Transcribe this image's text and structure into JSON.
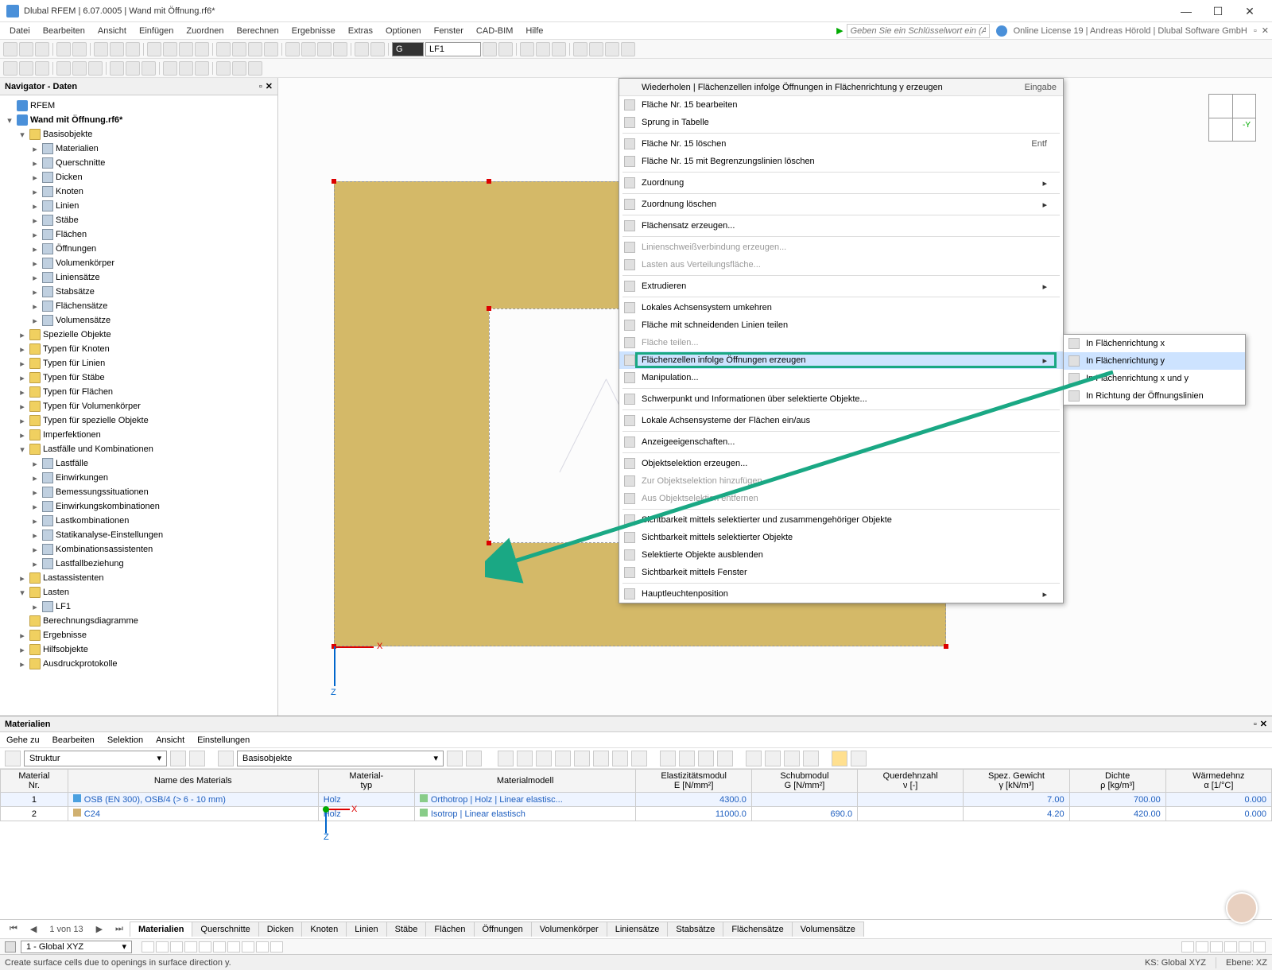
{
  "window": {
    "title": "Dlubal RFEM | 6.07.0005 | Wand mit Öffnung.rf6*",
    "license": "Online License 19 | Andreas Hörold | Dlubal Software GmbH",
    "search_placeholder": "Geben Sie ein Schlüsselwort ein (Alt..."
  },
  "menu": [
    "Datei",
    "Bearbeiten",
    "Ansicht",
    "Einfügen",
    "Zuordnen",
    "Berechnen",
    "Ergebnisse",
    "Extras",
    "Optionen",
    "Fenster",
    "CAD-BIM",
    "Hilfe"
  ],
  "toolbar_combo_g": "G",
  "toolbar_combo_lf": "LF1",
  "navigator": {
    "title": "Navigator - Daten",
    "root": "RFEM",
    "model": "Wand mit Öffnung.rf6*",
    "groups": [
      {
        "label": "Basisobjekte",
        "expanded": true,
        "children": [
          "Materialien",
          "Querschnitte",
          "Dicken",
          "Knoten",
          "Linien",
          "Stäbe",
          "Flächen",
          "Öffnungen",
          "Volumenkörper",
          "Liniensätze",
          "Stabsätze",
          "Flächensätze",
          "Volumensätze"
        ]
      },
      {
        "label": "Spezielle Objekte"
      },
      {
        "label": "Typen für Knoten"
      },
      {
        "label": "Typen für Linien"
      },
      {
        "label": "Typen für Stäbe"
      },
      {
        "label": "Typen für Flächen"
      },
      {
        "label": "Typen für Volumenkörper"
      },
      {
        "label": "Typen für spezielle Objekte"
      },
      {
        "label": "Imperfektionen"
      },
      {
        "label": "Lastfälle und Kombinationen",
        "expanded": true,
        "children": [
          "Lastfälle",
          "Einwirkungen",
          "Bemessungssituationen",
          "Einwirkungskombinationen",
          "Lastkombinationen",
          "Statikanalyse-Einstellungen",
          "Kombinationsassistenten",
          "Lastfallbeziehung"
        ]
      },
      {
        "label": "Lastassistenten"
      },
      {
        "label": "Lasten",
        "expanded": true,
        "children": [
          "LF1"
        ]
      },
      {
        "label": "Berechnungsdiagramme",
        "leaf": true
      },
      {
        "label": "Ergebnisse"
      },
      {
        "label": "Hilfsobjekte"
      },
      {
        "label": "Ausdruckprotokolle"
      }
    ]
  },
  "axis_widget": "-Y",
  "context_menu": {
    "header_left": "Wiederholen | Flächenzellen infolge Öffnungen in Flächenrichtung y erzeugen",
    "header_right": "Eingabe",
    "items": [
      {
        "label": "Fläche Nr. 15 bearbeiten"
      },
      {
        "label": "Sprung in Tabelle"
      },
      {
        "sep": true
      },
      {
        "label": "Fläche Nr. 15 löschen",
        "shortcut": "Entf"
      },
      {
        "label": "Fläche Nr. 15 mit Begrenzungslinien löschen"
      },
      {
        "sep": true
      },
      {
        "label": "Zuordnung",
        "arrow": true
      },
      {
        "sep": true
      },
      {
        "label": "Zuordnung löschen",
        "arrow": true
      },
      {
        "sep": true
      },
      {
        "label": "Flächensatz erzeugen..."
      },
      {
        "sep": true
      },
      {
        "label": "Linienschweißverbindung erzeugen...",
        "disabled": true
      },
      {
        "label": "Lasten aus Verteilungsfläche...",
        "disabled": true
      },
      {
        "sep": true
      },
      {
        "label": "Extrudieren",
        "arrow": true
      },
      {
        "sep": true
      },
      {
        "label": "Lokales Achsensystem umkehren"
      },
      {
        "label": "Fläche mit schneidenden Linien teilen"
      },
      {
        "label": "Fläche teilen...",
        "disabled": true
      },
      {
        "label": "Flächenzellen infolge Öffnungen erzeugen",
        "arrow": true,
        "highlight": true
      },
      {
        "label": "Manipulation..."
      },
      {
        "sep": true
      },
      {
        "label": "Schwerpunkt und Informationen über selektierte Objekte..."
      },
      {
        "sep": true
      },
      {
        "label": "Lokale Achsensysteme der Flächen ein/aus",
        "check": true
      },
      {
        "sep": true
      },
      {
        "label": "Anzeigeeigenschaften..."
      },
      {
        "sep": true
      },
      {
        "label": "Objektselektion erzeugen..."
      },
      {
        "label": "Zur Objektselektion hinzufügen",
        "disabled": true
      },
      {
        "label": "Aus Objektselektion entfernen",
        "disabled": true
      },
      {
        "sep": true
      },
      {
        "label": "Sichtbarkeit mittels selektierter und zusammengehöriger Objekte"
      },
      {
        "label": "Sichtbarkeit mittels selektierter Objekte"
      },
      {
        "label": "Selektierte Objekte ausblenden"
      },
      {
        "label": "Sichtbarkeit mittels Fenster"
      },
      {
        "sep": true
      },
      {
        "label": "Hauptleuchtenposition",
        "arrow": true
      }
    ],
    "submenu": [
      "In Flächenrichtung x",
      "In Flächenrichtung y",
      "In Flächenrichtung x und y",
      "In Richtung der Öffnungslinien"
    ],
    "submenu_highlight_index": 1
  },
  "materials_panel": {
    "title": "Materialien",
    "menus": [
      "Gehe zu",
      "Bearbeiten",
      "Selektion",
      "Ansicht",
      "Einstellungen"
    ],
    "combo_left": "Struktur",
    "combo_right": "Basisobjekte",
    "columns_top": [
      "Material\nNr.",
      "Name des Materials",
      "Material-\ntyp",
      "Materialmodell",
      "Elastizitätsmodul\nE [N/mm²]",
      "Schubmodul\nG [N/mm²]",
      "Querdehnzahl\nν [-]",
      "Spez. Gewicht\nγ [kN/m³]",
      "Dichte\nρ [kg/m³]",
      "Wärmedehnz\nα [1/°C]"
    ],
    "rows": [
      {
        "nr": "1",
        "name": "OSB (EN 300), OSB/4 (> 6 - 10 mm)",
        "typ": "Holz",
        "modell": "Orthotrop | Holz | Linear elastisc...",
        "e": "4300.0",
        "g": "",
        "v": "",
        "gamma": "7.00",
        "rho": "700.00",
        "alpha": "0.000"
      },
      {
        "nr": "2",
        "name": "C24",
        "typ": "Holz",
        "modell": "Isotrop | Linear elastisch",
        "e": "11000.0",
        "g": "690.0",
        "v": "",
        "gamma": "4.20",
        "rho": "420.00",
        "alpha": "0.000"
      }
    ],
    "page_info": "1 von 13",
    "tabs": [
      "Materialien",
      "Querschnitte",
      "Dicken",
      "Knoten",
      "Linien",
      "Stäbe",
      "Flächen",
      "Öffnungen",
      "Volumenkörper",
      "Liniensätze",
      "Stabsätze",
      "Flächensätze",
      "Volumensätze"
    ],
    "active_tab": 0
  },
  "status": {
    "left_combo": "1 - Global XYZ",
    "hint": "Create surface cells due to openings in surface direction y.",
    "ks": "KS: Global XYZ",
    "ebene": "Ebene: XZ"
  }
}
